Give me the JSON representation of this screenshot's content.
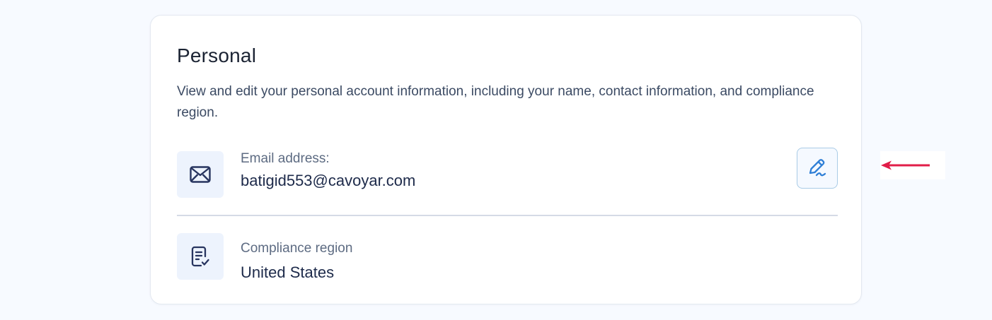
{
  "personal": {
    "title": "Personal",
    "description": "View and edit your personal account information, including your name, contact information, and compliance region."
  },
  "email": {
    "label": "Email address:",
    "value": "batigid553@cavoyar.com",
    "icon": "mail-icon",
    "edit_icon": "pen-icon"
  },
  "region": {
    "label": "Compliance region",
    "value": "United States",
    "icon": "document-check-icon"
  },
  "annotation": {
    "icon": "left-arrow-icon"
  },
  "colors": {
    "accent": "#2f7fd6",
    "icon_dark": "#27345f",
    "annotation_arrow": "#e11d48"
  }
}
